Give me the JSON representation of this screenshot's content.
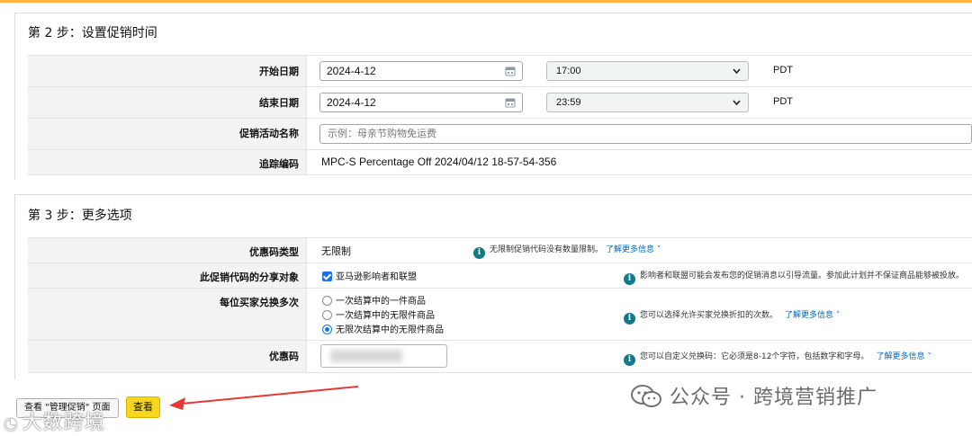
{
  "step2": {
    "title": "第 2 步：设置促销时间",
    "start_label": "开始日期",
    "start_date": "2024-4-12",
    "start_time": "17:00",
    "start_tz": "PDT",
    "end_label": "结束日期",
    "end_date": "2024-4-12",
    "end_time": "23:59",
    "end_tz": "PDT",
    "name_label": "促销活动名称",
    "name_placeholder": "示例：母亲节购物免运费",
    "tracking_label": "追踪编码",
    "tracking_value": "MPC-S Percentage Off 2024/04/12 18-57-54-356"
  },
  "step3": {
    "title": "第 3 步：更多选项",
    "code_type_label": "优惠码类型",
    "code_type_value": "无限制",
    "code_type_info": "无限制促销代码没有数量限制。",
    "share_label": "此促销代码的分享对象",
    "share_option": "亚马逊影响者和联盟",
    "share_info": "影响者和联盟可能会发布您的促销消息以引导流量。参加此计划并不保证商品能够被投放。",
    "redeem_label": "每位买家兑换多次",
    "redeem_options": [
      "一次结算中的一件商品",
      "一次结算中的无限件商品",
      "无限次结算中的无限件商品"
    ],
    "redeem_info": "您可以选择允许买家兑换折扣的次数。",
    "coupon_label": "优惠码",
    "coupon_info": "您可以自定义兑换码：它必须是8-12个字符，包括数字和字母。",
    "learn_more": "了解更多信息"
  },
  "footer": {
    "manage_button": "查看 \"管理促销\" 页面",
    "view_button": "查看"
  },
  "watermarks": {
    "left": "大数跨境",
    "right": "公众号 · 跨境营销推广"
  },
  "colors": {
    "accent_blue": "#1a73e8",
    "info_teal": "#0f7a8a",
    "primary_button": "#f7d620",
    "arrow_red": "#e53935"
  }
}
